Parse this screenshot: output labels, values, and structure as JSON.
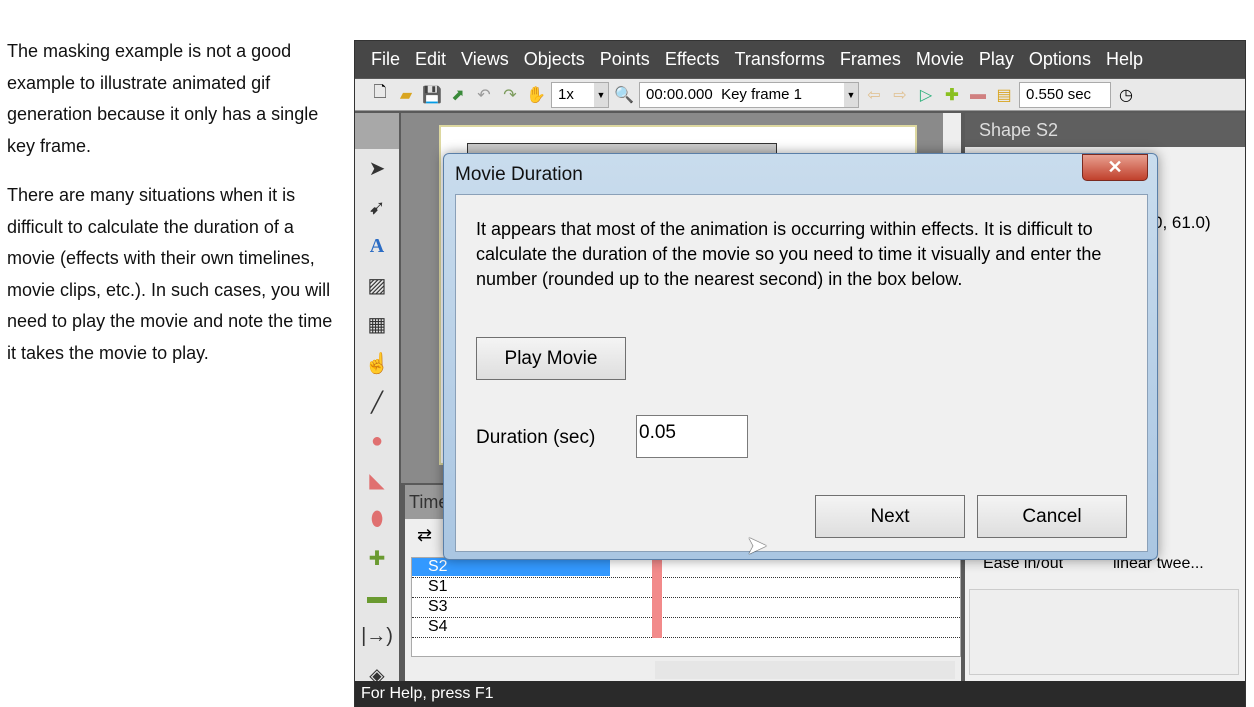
{
  "doc": {
    "paragraphs": [
      "The masking example is not a good example to illustrate animated gif generation because it only has a single key frame.",
      "There are many situations when it is difficult to calculate the duration of a movie (effects with their own timelines, movie clips, etc.). In such cases, you will need to play the movie and note the time it takes the movie to play."
    ]
  },
  "menu": [
    "File",
    "Edit",
    "Views",
    "Objects",
    "Points",
    "Effects",
    "Transforms",
    "Frames",
    "Movie",
    "Play",
    "Options",
    "Help"
  ],
  "toolbar": {
    "zoom": "1x",
    "frame": "00:00.000  Key frame 1",
    "time": "0.550 sec"
  },
  "timeline": {
    "title": "Time",
    "rows": [
      "S2",
      "S1",
      "S3",
      "S4"
    ]
  },
  "right_panel": {
    "title": "Shape S2",
    "value": "0, 61.0)",
    "prop_label": "Ease in/out",
    "prop_value": "linear twee..."
  },
  "status": "For Help, press F1",
  "dialog": {
    "title": "Movie Duration",
    "close": "✕",
    "message": "It appears that most of the animation is occurring within effects. It is difficult to calculate the duration of the movie so you need to time it visually and enter the number (rounded up to the nearest second) in the box below.",
    "play": "Play Movie",
    "duration_label": "Duration (sec)",
    "duration_value": "0.05",
    "next": "Next",
    "cancel": "Cancel"
  }
}
